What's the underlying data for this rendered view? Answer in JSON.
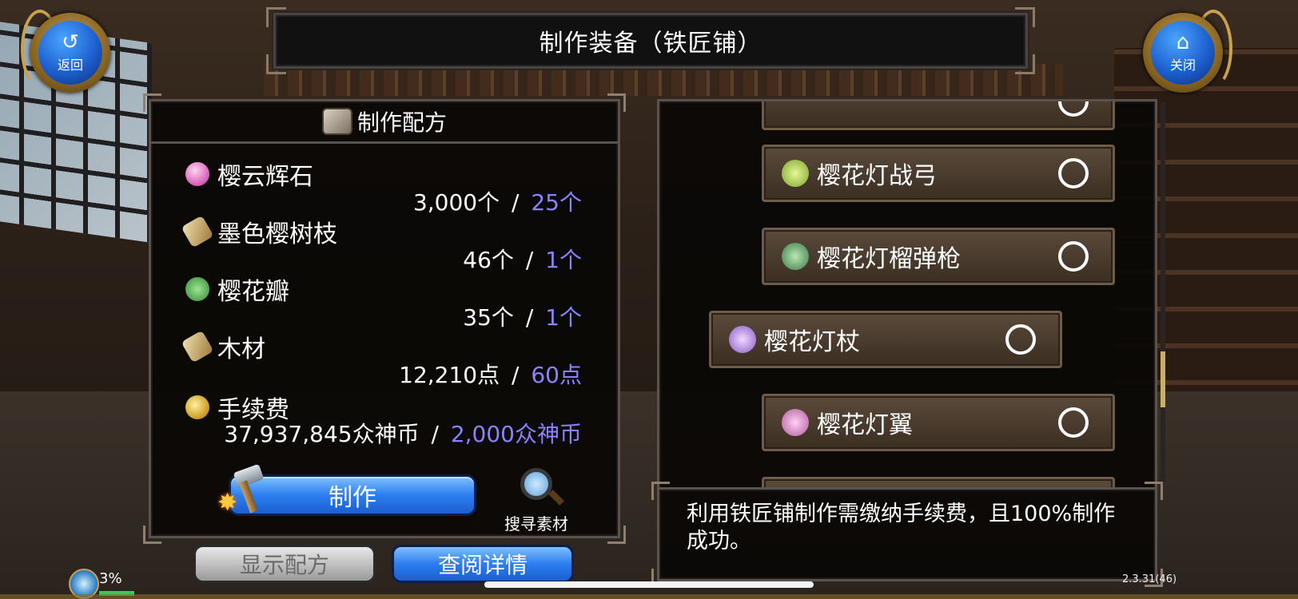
{
  "title": "制作装备（铁匠铺）",
  "nav": {
    "back_label": "返回",
    "close_label": "关闭"
  },
  "recipe": {
    "header": "制作配方",
    "materials": [
      {
        "name": "樱云辉石",
        "have": "3,000个",
        "need": "25个",
        "icon": "pink-gem-icon"
      },
      {
        "name": "墨色樱树枝",
        "have": "46个",
        "need": "1个",
        "icon": "branch-icon"
      },
      {
        "name": "樱花瓣",
        "have": "35个",
        "need": "1个",
        "icon": "leaf-icon"
      },
      {
        "name": "木材",
        "have": "12,210点",
        "need": "60点",
        "icon": "wood-icon"
      }
    ],
    "fee": {
      "name": "手续费",
      "have": "37,937,845众神币",
      "need": "2,000众神币",
      "icon": "coin-icon"
    },
    "separator": "/",
    "craft_label": "制作",
    "search_label": "搜寻素材"
  },
  "equipment_list": [
    {
      "name": "樱花灯战弓",
      "icon": "bow-icon",
      "selected": false
    },
    {
      "name": "樱花灯榴弹枪",
      "icon": "gun-icon",
      "selected": false
    },
    {
      "name": "樱花灯杖",
      "icon": "staff-icon",
      "selected": true
    },
    {
      "name": "樱花灯翼",
      "icon": "wing-icon",
      "selected": false
    }
  ],
  "description": "利用铁匠铺制作需缴纳手续费，且100%制作成功。",
  "buttons": {
    "show_recipe": "显示配方",
    "view_details": "查阅详情"
  },
  "status": {
    "progress_text": "3%",
    "progress": 0.03,
    "version": "2.3.31(46)"
  },
  "colors": {
    "need_value": "#8b82ff",
    "button_blue": "#2c7ef0",
    "panel_bg": "#0a0806"
  }
}
